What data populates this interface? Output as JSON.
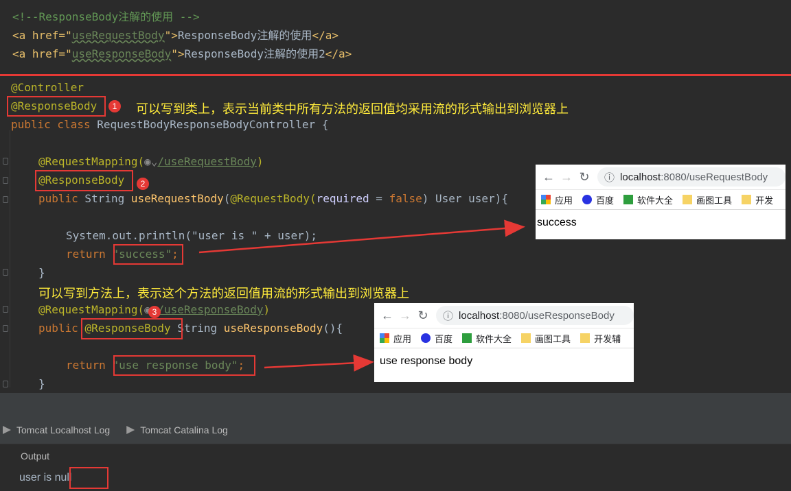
{
  "html_snippet": {
    "comment": "<!--ResponseBody注解的使用 -->",
    "link1_prefix": "<a href=\"",
    "link1_href": "useRequestBody",
    "link1_suffix": "\">",
    "link1_text": "ResponseBody注解的使用",
    "link1_close": "</a>",
    "link2_prefix": "<a href=\"",
    "link2_href": "useResponseBody",
    "link2_suffix": "\">",
    "link2_text": "ResponseBody注解的使用2",
    "link2_close": "</a>"
  },
  "code": {
    "l1": "@Controller",
    "l2": "@ResponseBody",
    "l3_kw": "public class",
    "l3_name": " RequestBodyResponseBodyController {",
    "l4_ann": "@RequestMapping(",
    "l4_path": "/useRequestBody",
    "l4_close": ")",
    "l5": "@ResponseBody",
    "l6_kw": "public",
    "l6_type": " String ",
    "l6_fn": "useRequestBody",
    "l6_open": "(",
    "l6_ann": "@RequestBody",
    "l6_param_open": "(",
    "l6_required": "required",
    "l6_eq": " = ",
    "l6_false": "false",
    "l6_rest": ") User user){",
    "l7": "System.out.println(\"user is \" + user);",
    "l8_kw": "return ",
    "l8_str": "\"success\"",
    "l8_end": ";",
    "l9": "}",
    "l10_ann": "@RequestMapping(",
    "l10_path": "/useResponseBody",
    "l10_close": ")",
    "l11_kw": "public ",
    "l11_ann": "@ResponseBody",
    "l11_type": " String ",
    "l11_fn": "useResponseBody",
    "l11_rest": "(){",
    "l12_kw": "return ",
    "l12_str": "\"use response body\"",
    "l12_end": ";",
    "l13": "}"
  },
  "annotations": {
    "badge1": "1",
    "badge2": "2",
    "badge3": "3",
    "note1": "可以写到类上，表示当前类中所有方法的返回值均采用流的形式输出到浏览器上",
    "note2": "可以写到方法上，表示这个方法的返回值用流的形式输出到浏览器上"
  },
  "browser1": {
    "url_host": "localhost",
    "url_rest": ":8080/useRequestBody",
    "bookmarks": [
      "应用",
      "百度",
      "软件大全",
      "画图工具",
      "开发"
    ],
    "content": "success"
  },
  "browser2": {
    "url_host": "localhost",
    "url_rest": ":8080/useResponseBody",
    "bookmarks": [
      "应用",
      "百度",
      "软件大全",
      "画图工具",
      "开发辅"
    ],
    "content": "use response body"
  },
  "bottom": {
    "tab1": "Tomcat Localhost Log",
    "tab2": "Tomcat Catalina Log",
    "output_label": "Output",
    "output_prefix": "user is ",
    "output_value": "null"
  },
  "colors": {
    "editor_bg": "#2b2b2b",
    "highlight_red": "#e53935",
    "note_yellow": "#ffeb3b"
  }
}
